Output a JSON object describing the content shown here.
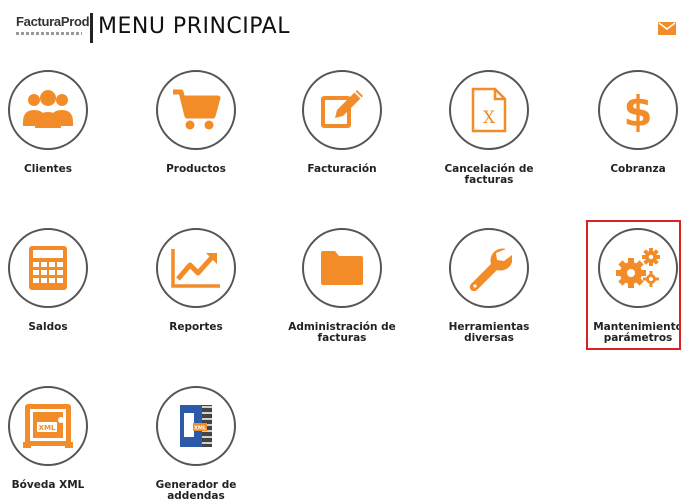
{
  "header": {
    "logo_text": "FacturaProd.",
    "title": "MENU PRINCIPAL"
  },
  "colors": {
    "accent": "#f28c28",
    "highlight": "#dd2222"
  },
  "menu": [
    {
      "label": "Clientes",
      "icon": "users-icon"
    },
    {
      "label": "Productos",
      "icon": "cart-icon"
    },
    {
      "label": "Facturación",
      "icon": "edit-icon"
    },
    {
      "label": "Cancelación de facturas",
      "icon": "excel-file-icon"
    },
    {
      "label": "Cobranza",
      "icon": "dollar-icon"
    },
    {
      "label": "Saldos",
      "icon": "calculator-icon"
    },
    {
      "label": "Reportes",
      "icon": "chart-icon"
    },
    {
      "label": "Administración de facturas",
      "icon": "folder-icon"
    },
    {
      "label": "Herramientas diversas",
      "icon": "wrench-icon"
    },
    {
      "label": "Mantenimiento parámetros",
      "icon": "gears-icon"
    },
    {
      "label": "Bóveda XML",
      "icon": "xml-vault-icon"
    },
    {
      "label": "Generador de addendas",
      "icon": "addenda-generator-icon"
    }
  ]
}
